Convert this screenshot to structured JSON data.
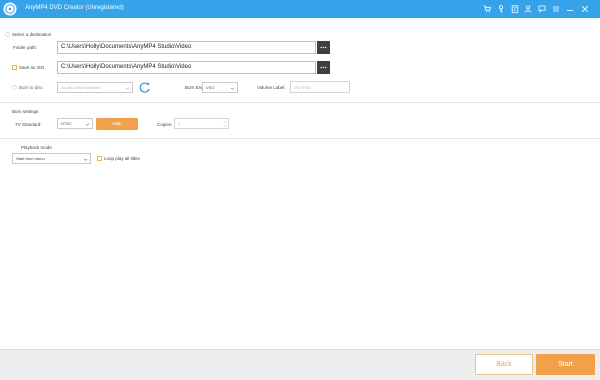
{
  "window": {
    "title": "AnyMP4 DVD Creator (Unregistered)",
    "toolbar_icons": [
      "cart-icon",
      "key-icon",
      "register-icon",
      "account-icon",
      "feedback-icon",
      "menu-icon",
      "minimize-icon",
      "close-icon"
    ]
  },
  "destination": {
    "section_label": "Select a destination",
    "folder_path_label": "Folder path:",
    "folder_path_value": "C:\\Users\\Holly\\Documents\\AnyMP4 Studio\\Video",
    "save_iso_label": "Save as ISO",
    "iso_path_value": "C:\\Users\\Holly\\Documents\\AnyMP4 Studio\\Video",
    "burn_to_disc_label": "Burn to disc",
    "disc_drive_value": "No disc drive detected",
    "burn_engine_label": "Burn Engine:",
    "burn_engine_value": "VSO",
    "volume_label_label": "Volume Label:",
    "volume_label_placeholder": "My DVD"
  },
  "burn_settings": {
    "section_label": "Burn settings",
    "tv_standard_label": "TV Standard:",
    "tv_standard_value": "NTSC",
    "help_label": "Help",
    "copies_label": "Copies:",
    "copies_value": "1"
  },
  "playback": {
    "section_label": "Playback mode",
    "mode_value": "Start from menu",
    "loop_label": "Loop play all titles"
  },
  "footer": {
    "back_label": "Back",
    "start_label": "Start"
  },
  "colors": {
    "titlebar": "#35a3ea",
    "accent": "#f3a04a",
    "browse_button": "#3f3f3f"
  }
}
